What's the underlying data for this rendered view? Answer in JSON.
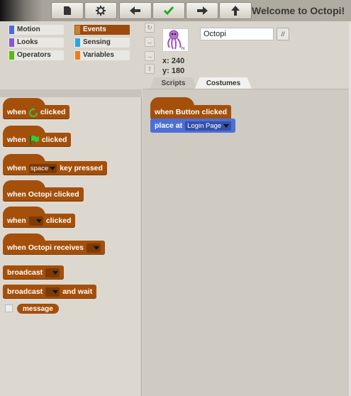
{
  "toolbar": {
    "title": "Welcome to Octopi!",
    "buttons": [
      {
        "name": "new-file-icon"
      },
      {
        "name": "settings-gear-icon"
      },
      {
        "name": "undo-arrow-left-icon"
      },
      {
        "name": "checkmark-icon",
        "color": "#22aa22"
      },
      {
        "name": "redo-arrow-right-icon"
      },
      {
        "name": "upload-arrow-up-icon"
      }
    ]
  },
  "categories": [
    {
      "label": "Motion",
      "color": "#4a6cd4"
    },
    {
      "label": "Events",
      "color": "#c88330",
      "selected": true
    },
    {
      "label": "Looks",
      "color": "#8a55d7"
    },
    {
      "label": "Sensing",
      "color": "#2ca5e2"
    },
    {
      "label": "Operators",
      "color": "#5cb712"
    },
    {
      "label": "Variables",
      "color": "#ee7d16"
    }
  ],
  "palette": {
    "when_flag_1_pre": "when",
    "when_flag_1_post": "clicked",
    "when_flag_2_pre": "when",
    "when_flag_2_post": "clicked",
    "when_key_pre": "when",
    "when_key_value": "space",
    "when_key_post": "key pressed",
    "when_octopi_clicked": "when Octopi clicked",
    "when_blank_pre": "when",
    "when_blank_post": "clicked",
    "when_receives": "when Octopi receives",
    "broadcast": "broadcast",
    "broadcast_wait_pre": "broadcast",
    "broadcast_wait_post": "and wait",
    "message": "message"
  },
  "sprite": {
    "name": "Octopi",
    "x_label": "x: 240",
    "y_label": "y: 180",
    "edit_icon_text": "//"
  },
  "tabs": [
    {
      "label": "Scripts",
      "active": true
    },
    {
      "label": "Costumes",
      "active": false
    }
  ],
  "scripts": {
    "hat_label": "when Button clicked",
    "place_at": "place at",
    "place_target": "Login Page"
  }
}
